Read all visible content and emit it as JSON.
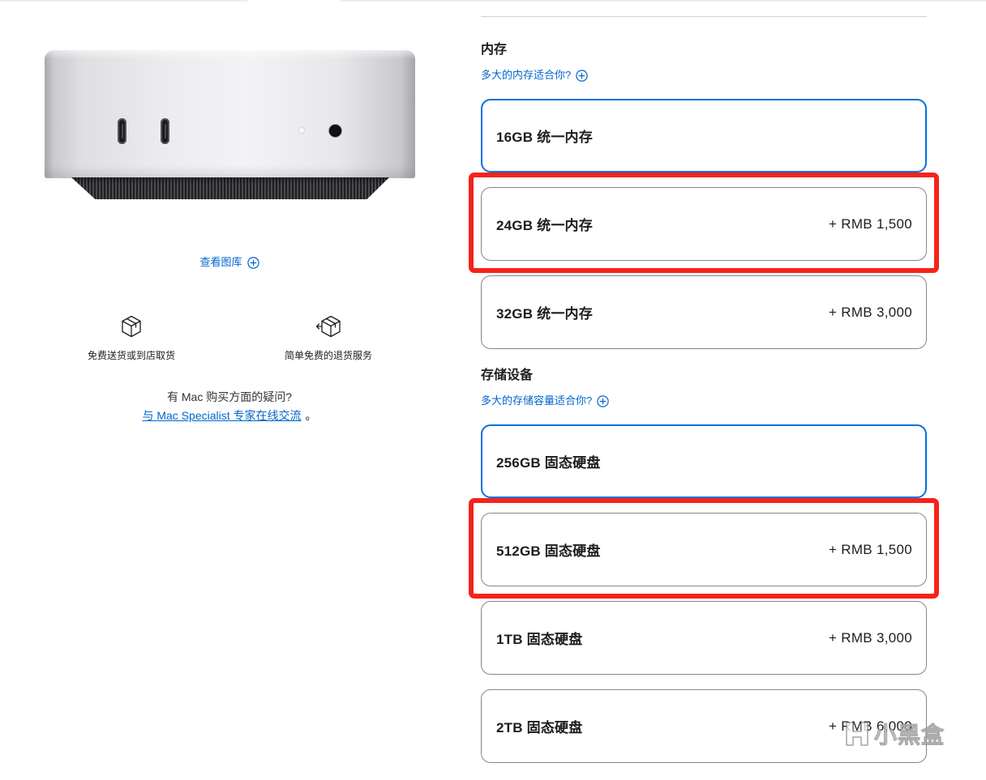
{
  "colors": {
    "accent": "#0071e3",
    "link": "#0066cc",
    "text": "#1d1d1f",
    "border": "#86868b",
    "annotation": "#f5231b"
  },
  "gallery": {
    "link_label": "查看图库",
    "link_icon": "plus-circle-icon"
  },
  "services": [
    {
      "icon": "shipping-box-icon",
      "label": "免费送货或到店取货"
    },
    {
      "icon": "return-box-icon",
      "label": "简单免费的退货服务"
    }
  ],
  "help": {
    "question": "有 Mac 购买方面的疑问?",
    "link_label": "与 Mac Specialist 专家在线交流",
    "suffix": "。"
  },
  "memory": {
    "title": "内存",
    "help_link": "多大的内存适合你?",
    "help_icon": "plus-circle-icon",
    "options": [
      {
        "label": "16GB 统一内存",
        "price": "",
        "selected": true,
        "annotated": false
      },
      {
        "label": "24GB 统一内存",
        "price": "+ RMB 1,500",
        "selected": false,
        "annotated": true
      },
      {
        "label": "32GB 统一内存",
        "price": "+ RMB 3,000",
        "selected": false,
        "annotated": false
      }
    ]
  },
  "storage": {
    "title": "存储设备",
    "help_link": "多大的存储容量适合你?",
    "help_icon": "plus-circle-icon",
    "options": [
      {
        "label": "256GB 固态硬盘",
        "price": "",
        "selected": true,
        "annotated": false
      },
      {
        "label": "512GB 固态硬盘",
        "price": "+ RMB 1,500",
        "selected": false,
        "annotated": true
      },
      {
        "label": "1TB 固态硬盘",
        "price": "+ RMB 3,000",
        "selected": false,
        "annotated": false
      },
      {
        "label": "2TB 固态硬盘",
        "price": "+ RMB 6,000",
        "selected": false,
        "annotated": false
      }
    ]
  },
  "watermark": {
    "icon": "xiaoheihe-logo-icon",
    "text": "小黑盒"
  }
}
